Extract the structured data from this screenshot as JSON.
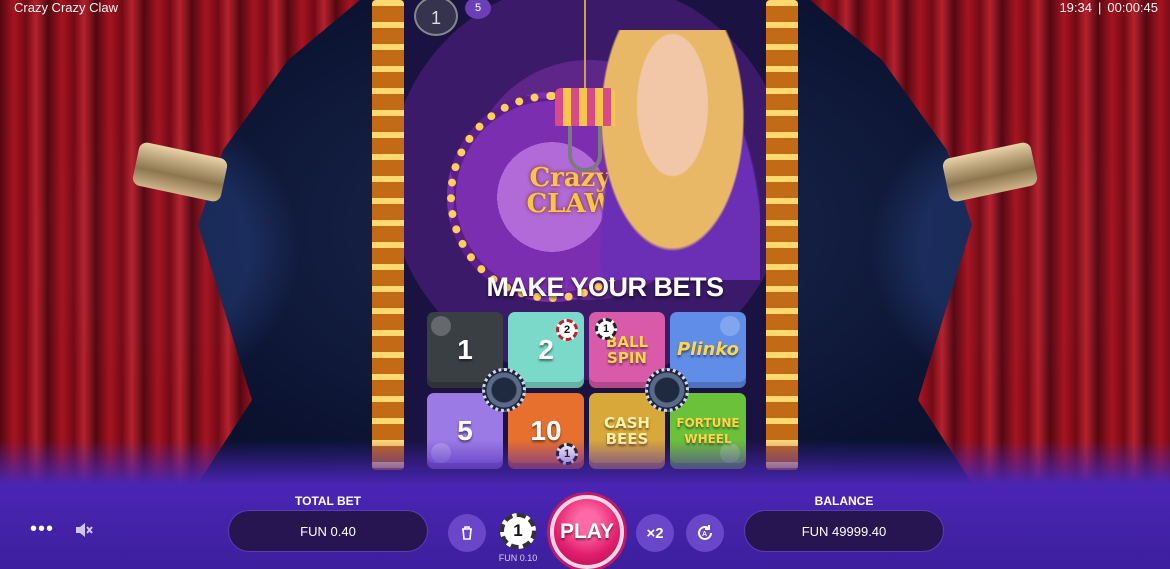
{
  "header": {
    "game_title": "Crazy Crazy Claw",
    "time": "19:34",
    "separator": "|",
    "elapsed": "00:00:45"
  },
  "round_markers": [
    "1",
    "5"
  ],
  "logo": "Crazy CLAW",
  "stage": {
    "headline": "MAKE YOUR BETS"
  },
  "bet_tiles": [
    {
      "label": "1",
      "color": "#3a3f44",
      "chip": ""
    },
    {
      "label": "2",
      "color": "#7ad9c8",
      "chip": "2"
    },
    {
      "label": "BALL SPIN",
      "color": "#d85aa8",
      "chip": "1"
    },
    {
      "label": "Plinko",
      "color": "#5f8de8",
      "chip": ""
    },
    {
      "label": "5",
      "color": "#9b7ae6",
      "chip": ""
    },
    {
      "label": "10",
      "color": "#e8702e",
      "chip": "1"
    },
    {
      "label": "CASH BEES",
      "color": "#d9a83a",
      "chip": ""
    },
    {
      "label": "FORTUNE WHEEL",
      "color": "#6cc13a",
      "chip": ""
    }
  ],
  "controls": {
    "total_bet_label": "TOTAL BET",
    "total_bet_value": "FUN 0.40",
    "chip_value": "1",
    "chip_caption": "FUN 0.10",
    "play_label": "PLAY",
    "double_label": "×2",
    "balance_label": "BALANCE",
    "balance_value": "FUN 49999.40",
    "icons": [
      "menu-dots-icon",
      "mute-icon",
      "trash-icon",
      "autoplay-icon"
    ]
  }
}
